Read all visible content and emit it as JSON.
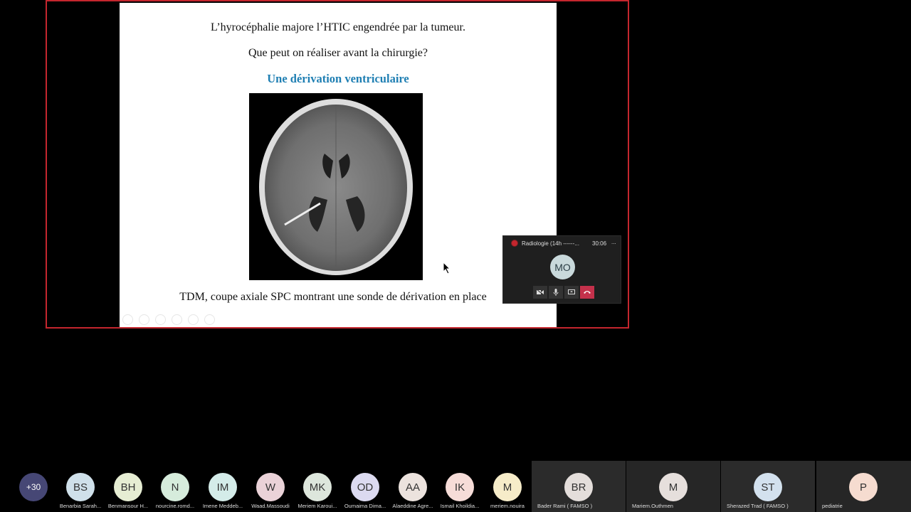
{
  "slide": {
    "line1": "L’hyrocéphalie majore l’HTIC engendrée par la tumeur.",
    "line2": "Que peut on réaliser avant la chirurgie?",
    "line3": "Une dérivation ventriculaire",
    "caption": "TDM, coupe axiale SPC montrant une sonde de dérivation en place",
    "accent_color": "#1f7fb3"
  },
  "mini_call": {
    "title": "Radiologie (14h ------...",
    "timer": "30:06",
    "more": "...",
    "avatar_initials": "MO",
    "controls": [
      "camera-icon",
      "microphone-icon",
      "share-screen-icon",
      "hang-up-icon"
    ]
  },
  "participants": {
    "overflow": "+30",
    "avatars": [
      {
        "initials": "BS",
        "name": "Benarbia Sarah...",
        "color": "#cfe0ea"
      },
      {
        "initials": "BH",
        "name": "Benmansour H...",
        "color": "#e6edd3"
      },
      {
        "initials": "N",
        "name": "nourcine.romd...",
        "color": "#d6ecdc"
      },
      {
        "initials": "IM",
        "name": "Imene Meddeb...",
        "color": "#d4ece9"
      },
      {
        "initials": "W",
        "name": "Waad.Massoudi",
        "color": "#ead2d8"
      },
      {
        "initials": "MK",
        "name": "Meriem Karoui...",
        "color": "#dde6dc"
      },
      {
        "initials": "OD",
        "name": "Oumaima Dima...",
        "color": "#dcdaf0"
      },
      {
        "initials": "AA",
        "name": "Alaeddine Agre...",
        "color": "#ece3de"
      },
      {
        "initials": "IK",
        "name": "Ismail Khoildia...",
        "color": "#f6dcd8"
      },
      {
        "initials": "M",
        "name": "meriem.nouira",
        "color": "#f6ecc9"
      }
    ],
    "tiles": [
      {
        "initials": "BR",
        "name": "Bader Rami ( FAMSO )",
        "color": "#e4dedb"
      },
      {
        "initials": "M",
        "name": "Mariem.Outhmen",
        "color": "#e6dfdc"
      },
      {
        "initials": "ST",
        "name": "Sherazed Trad ( FAMSO )",
        "color": "#d3e1ee"
      },
      {
        "initials": "P",
        "name": "pediatrie",
        "color": "#f6dcd0"
      }
    ]
  }
}
